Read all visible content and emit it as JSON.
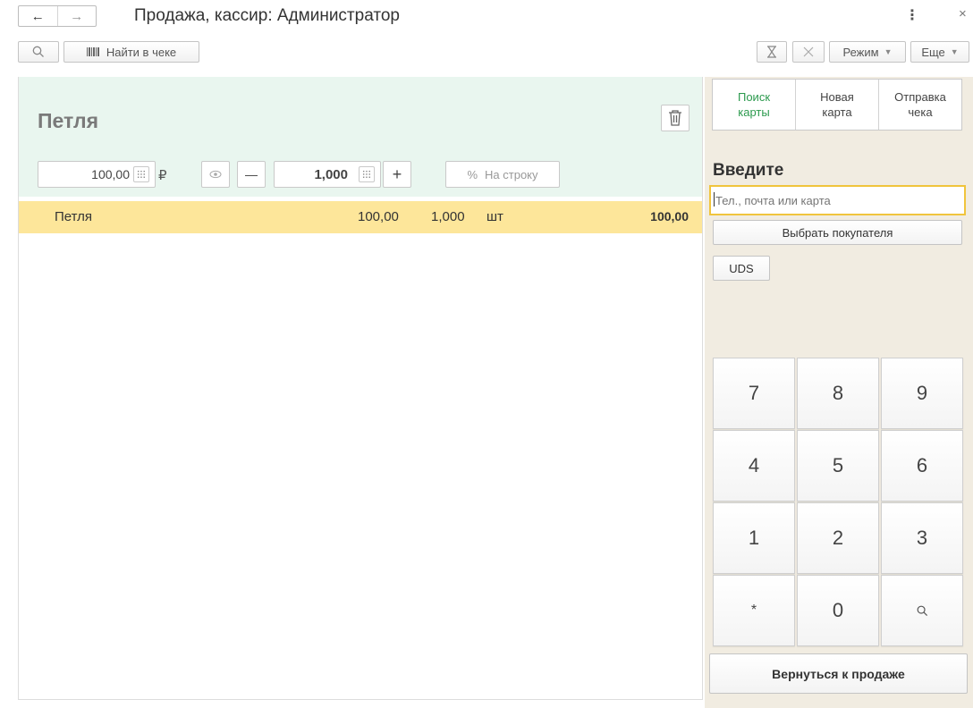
{
  "window": {
    "title": "Продажа, кассир: Администратор",
    "back_glyph": "←",
    "forward_glyph": "→",
    "more_glyph": "⋮",
    "close_glyph": "×"
  },
  "toolbar": {
    "find_in_receipt": "Найти в чеке",
    "mode": "Режим",
    "more": "Еще"
  },
  "item": {
    "name": "Петля",
    "price": "100,00",
    "currency": "₽",
    "quantity": "1,000",
    "minus": "—",
    "plus": "+",
    "discount_percent": "%",
    "discount_label": "На строку"
  },
  "receipt_rows": [
    {
      "name": "Петля",
      "price": "100,00",
      "qty": "1,000",
      "unit": "шт",
      "sum": "100,00"
    }
  ],
  "customer": {
    "tabs": [
      {
        "label_line1": "Поиск",
        "label_line2": "карты",
        "active": true
      },
      {
        "label_line1": "Новая",
        "label_line2": "карта",
        "active": false
      },
      {
        "label_line1": "Отправка",
        "label_line2": "чека",
        "active": false
      }
    ],
    "enter_label": "Введите",
    "input_placeholder": "Тел., почта или карта",
    "choose_customer": "Выбрать покупателя",
    "uds": "UDS"
  },
  "keypad": {
    "keys": [
      "7",
      "8",
      "9",
      "4",
      "5",
      "6",
      "1",
      "2",
      "3",
      "*",
      "0",
      "search-icon"
    ]
  },
  "return_button": "Вернуться к продаже",
  "colors": {
    "item_header_bg": "#e9f6ef",
    "selected_row_bg": "#fde69a",
    "right_panel_bg": "#f1ece1",
    "active_tab": "#2c9a4e",
    "input_focus_border": "#f0c43c"
  }
}
